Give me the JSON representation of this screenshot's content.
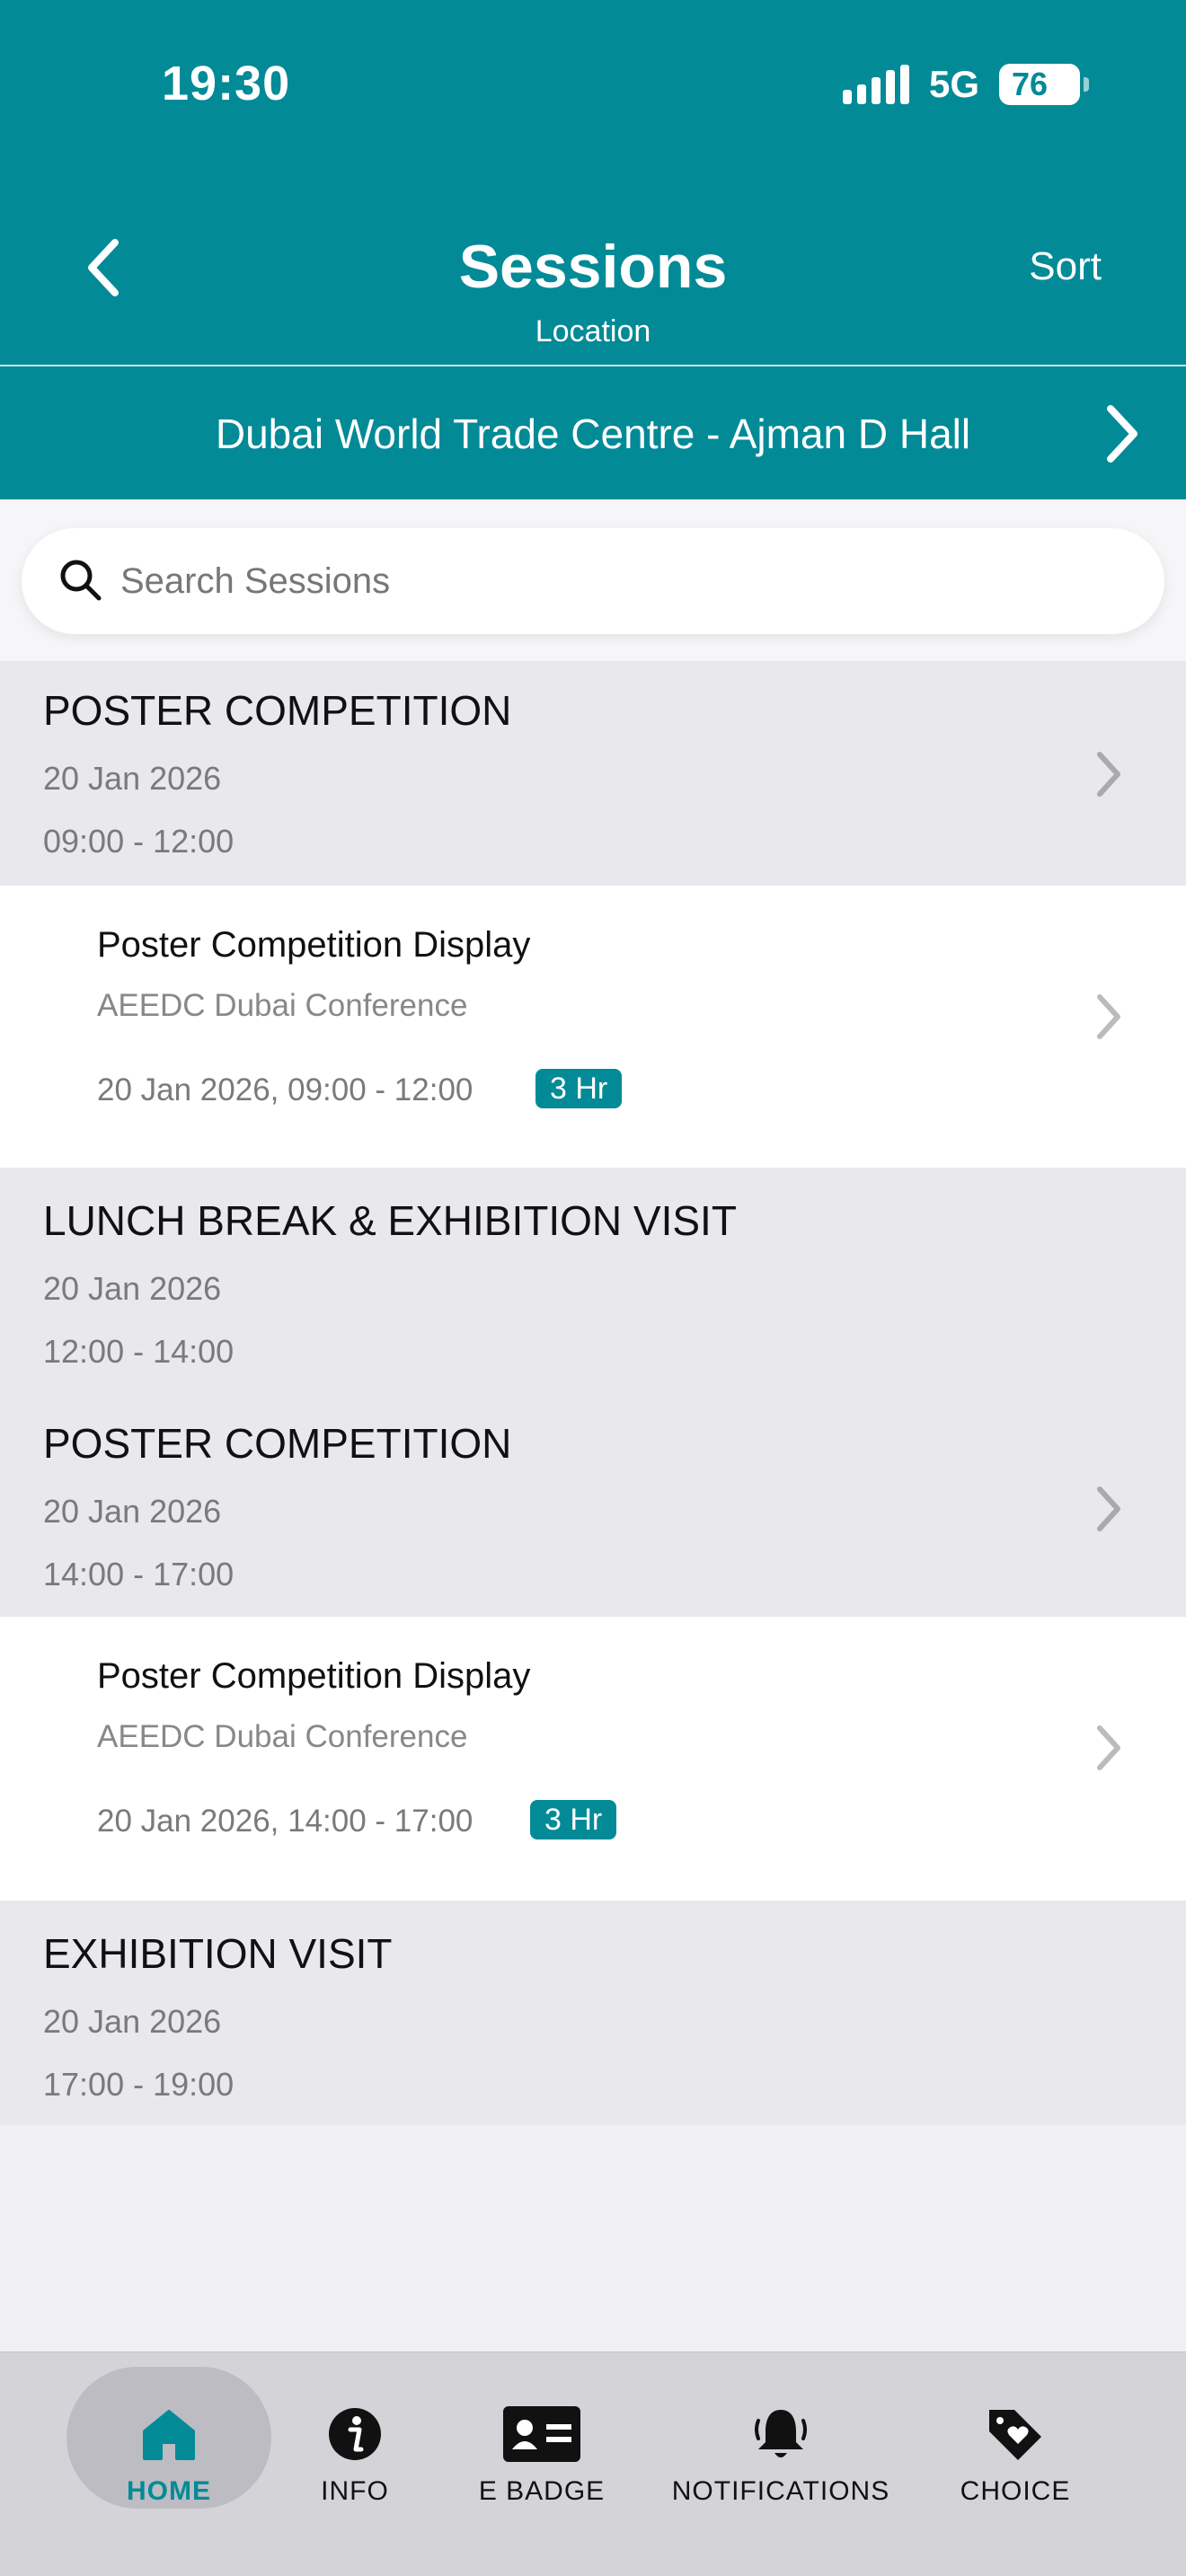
{
  "status_bar": {
    "time": "19:30",
    "network": "5G",
    "battery": "76"
  },
  "header": {
    "title": "Sessions",
    "subtitle": "Location",
    "sort_label": "Sort"
  },
  "location": {
    "name": "Dubai World Trade Centre - Ajman D Hall"
  },
  "search": {
    "placeholder": "Search Sessions"
  },
  "groups": [
    {
      "title": "POSTER COMPETITION",
      "date": "20 Jan 2026",
      "time": "09:00 - 12:00"
    },
    {
      "title": "LUNCH BREAK & EXHIBITION VISIT",
      "date": "20 Jan 2026",
      "time": "12:00 - 14:00"
    },
    {
      "title": "POSTER COMPETITION",
      "date": "20 Jan 2026",
      "time": "14:00 - 17:00"
    },
    {
      "title": "EXHIBITION VISIT",
      "date": "20 Jan 2026",
      "time": "17:00 - 19:00"
    }
  ],
  "sessions": [
    {
      "title": "Poster Competition Display",
      "event": "AEEDC Dubai Conference",
      "when": "20 Jan 2026, 09:00 - 12:00",
      "duration": "3 Hr"
    },
    {
      "title": "Poster Competition Display",
      "event": "AEEDC Dubai Conference",
      "when": "20 Jan 2026, 14:00 - 17:00",
      "duration": "3 Hr"
    }
  ],
  "tabs": [
    {
      "label": "HOME",
      "icon": "home-icon",
      "active": true
    },
    {
      "label": "INFO",
      "icon": "info-icon",
      "active": false
    },
    {
      "label": "E BADGE",
      "icon": "badge-card-icon",
      "active": false
    },
    {
      "label": "NOTIFICATIONS",
      "icon": "bell-icon",
      "active": false
    },
    {
      "label": "CHOICE",
      "icon": "tag-heart-icon",
      "active": false
    }
  ],
  "colors": {
    "brand": "#038a97",
    "group_bg": "#e8e8ed",
    "tabbar_bg": "#d4d4d8"
  }
}
